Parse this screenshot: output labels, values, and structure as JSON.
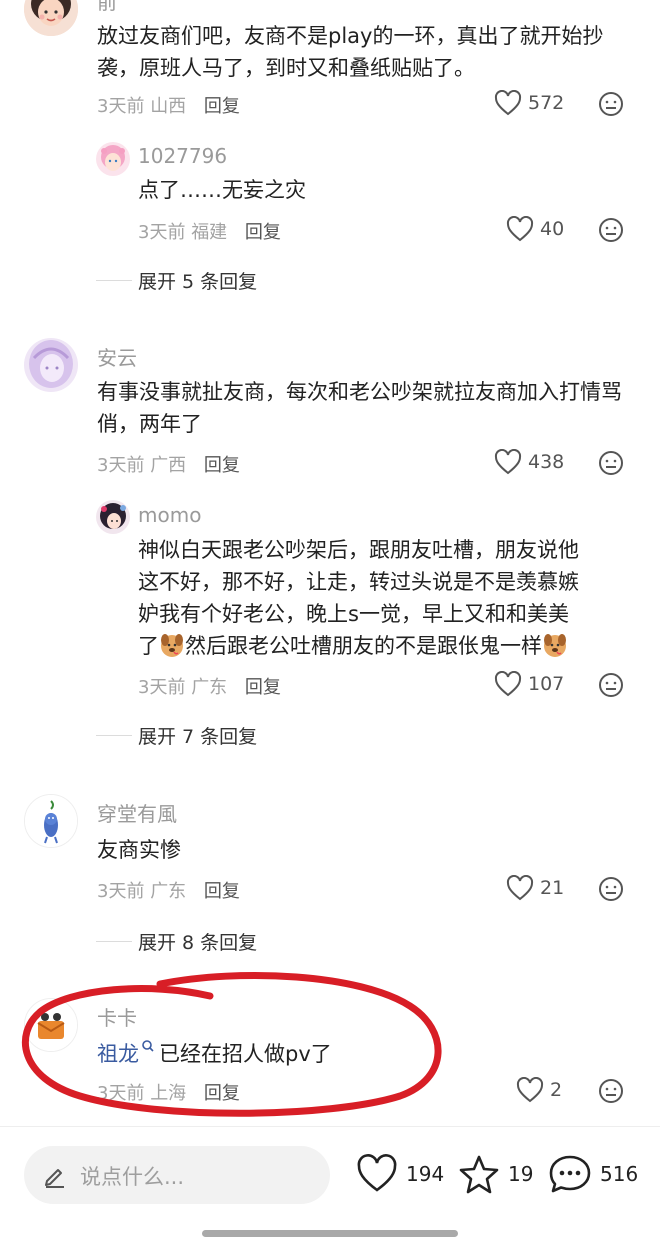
{
  "comments": [
    {
      "author": "前",
      "text": "放过友商们吧，友商不是play的一环，真出了就开始抄袭，原班人马了，到时又和叠纸贴贴了。",
      "time": "3天前",
      "region": "山西",
      "reply_label": "回复",
      "likes": "572",
      "replies": [
        {
          "author": "1027796",
          "text": "点了……无妄之灾",
          "time": "3天前",
          "region": "福建",
          "reply_label": "回复",
          "likes": "40"
        }
      ],
      "expand_label": "展开 5 条回复"
    },
    {
      "author": "安云",
      "text": "有事没事就扯友商，每次和老公吵架就拉友商加入打情骂俏，两年了",
      "time": "3天前",
      "region": "广西",
      "reply_label": "回复",
      "likes": "438",
      "replies": [
        {
          "author": "momo",
          "text_lines": [
            "神似白天跟老公吵架后，跟朋友吐槽，朋友说他",
            "这不好，那不好，让走，转过头说是不是羡慕嫉",
            "妒我有个好老公，晚上s一觉，早上又和和美美",
            "了",
            "然后跟老公吐槽朋友的不是跟伥鬼一样"
          ],
          "time": "3天前",
          "region": "广东",
          "reply_label": "回复",
          "likes": "107"
        }
      ],
      "expand_label": "展开 7 条回复"
    },
    {
      "author": "穿堂有風",
      "text": "友商实惨",
      "time": "3天前",
      "region": "广东",
      "reply_label": "回复",
      "likes": "21",
      "expand_label": "展开 8 条回复"
    },
    {
      "author": "卡卡",
      "mention": "祖龙",
      "text": "已经在招人做pv了",
      "time": "3天前",
      "region": "上海",
      "reply_label": "回复",
      "likes": "2"
    }
  ],
  "bottom_bar": {
    "input_placeholder": "说点什么...",
    "likes": "194",
    "favorites": "19",
    "comments": "516"
  },
  "colors": {
    "annotation_circle": "#d81e26",
    "mention": "#3a5ba0"
  }
}
